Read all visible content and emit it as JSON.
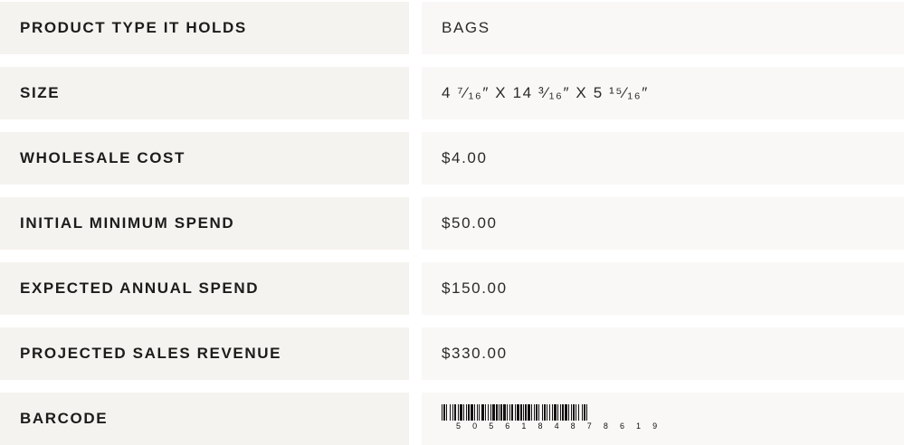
{
  "specs": [
    {
      "label": "PRODUCT TYPE IT HOLDS",
      "value": "BAGS"
    },
    {
      "label": "SIZE",
      "value": "4 ⁷⁄₁₆″ X 14 ³⁄₁₆″ X 5 ¹⁵⁄₁₆″"
    },
    {
      "label": "WHOLESALE COST",
      "value": "$4.00"
    },
    {
      "label": "INITIAL MINIMUM SPEND",
      "value": "$50.00"
    },
    {
      "label": "EXPECTED ANNUAL SPEND",
      "value": "$150.00"
    },
    {
      "label": "PROJECTED SALES REVENUE",
      "value": "$330.00"
    },
    {
      "label": "BARCODE",
      "value": ""
    }
  ],
  "barcode": {
    "digits": [
      "5",
      "0",
      "5",
      "6",
      "1",
      "8",
      "4",
      "8",
      "7",
      "8",
      "6",
      "1",
      "9"
    ]
  },
  "colors": {
    "label_bg": "#f5f3ef",
    "value_bg": "#faf8f6",
    "text": "#1c1c1c"
  }
}
